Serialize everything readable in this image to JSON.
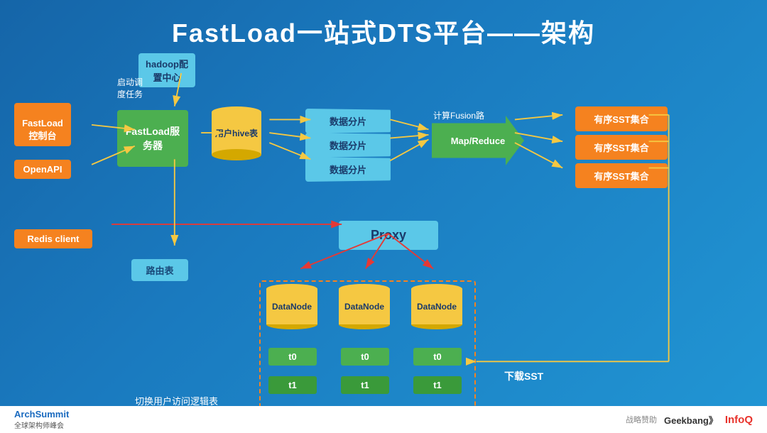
{
  "title": "FastLoad一站式DTS平台——架构",
  "hadoop": {
    "label": "hadoop配\n置中心"
  },
  "fastload_control": "FastLoad\n控制台",
  "openapi": "OpenAPI",
  "fastload_server": "FastLoad服\n务器",
  "start_task": "启动调\n度任务",
  "user_hive": "用户hive表",
  "data_shards": [
    "数据分片",
    "数据分片",
    "数据分片"
  ],
  "calc_label": "计算Fusion路\n由及构造SST",
  "mapreduce": "Map/Reduce",
  "sst_boxes": [
    "有序SST集合",
    "有序SST集合",
    "有序SST集合"
  ],
  "redis_client": "Redis client",
  "proxy": "Proxy",
  "routing_table": "路由表",
  "datanodes": [
    "DataNode",
    "DataNode",
    "DataNode"
  ],
  "tables_t0": [
    "t0",
    "t0",
    "t0"
  ],
  "tables_t1": [
    "t1",
    "t1",
    "t1"
  ],
  "download_sst": "下载SST",
  "switch_label": "切换用户访问逻辑表",
  "footer": {
    "arch_summit": "ArchSummit",
    "arch_summit_sub": "全球架构师峰会",
    "sponsor": "战略赞助",
    "geekbang": "Geekbang》",
    "infoq": "InfoQ"
  }
}
